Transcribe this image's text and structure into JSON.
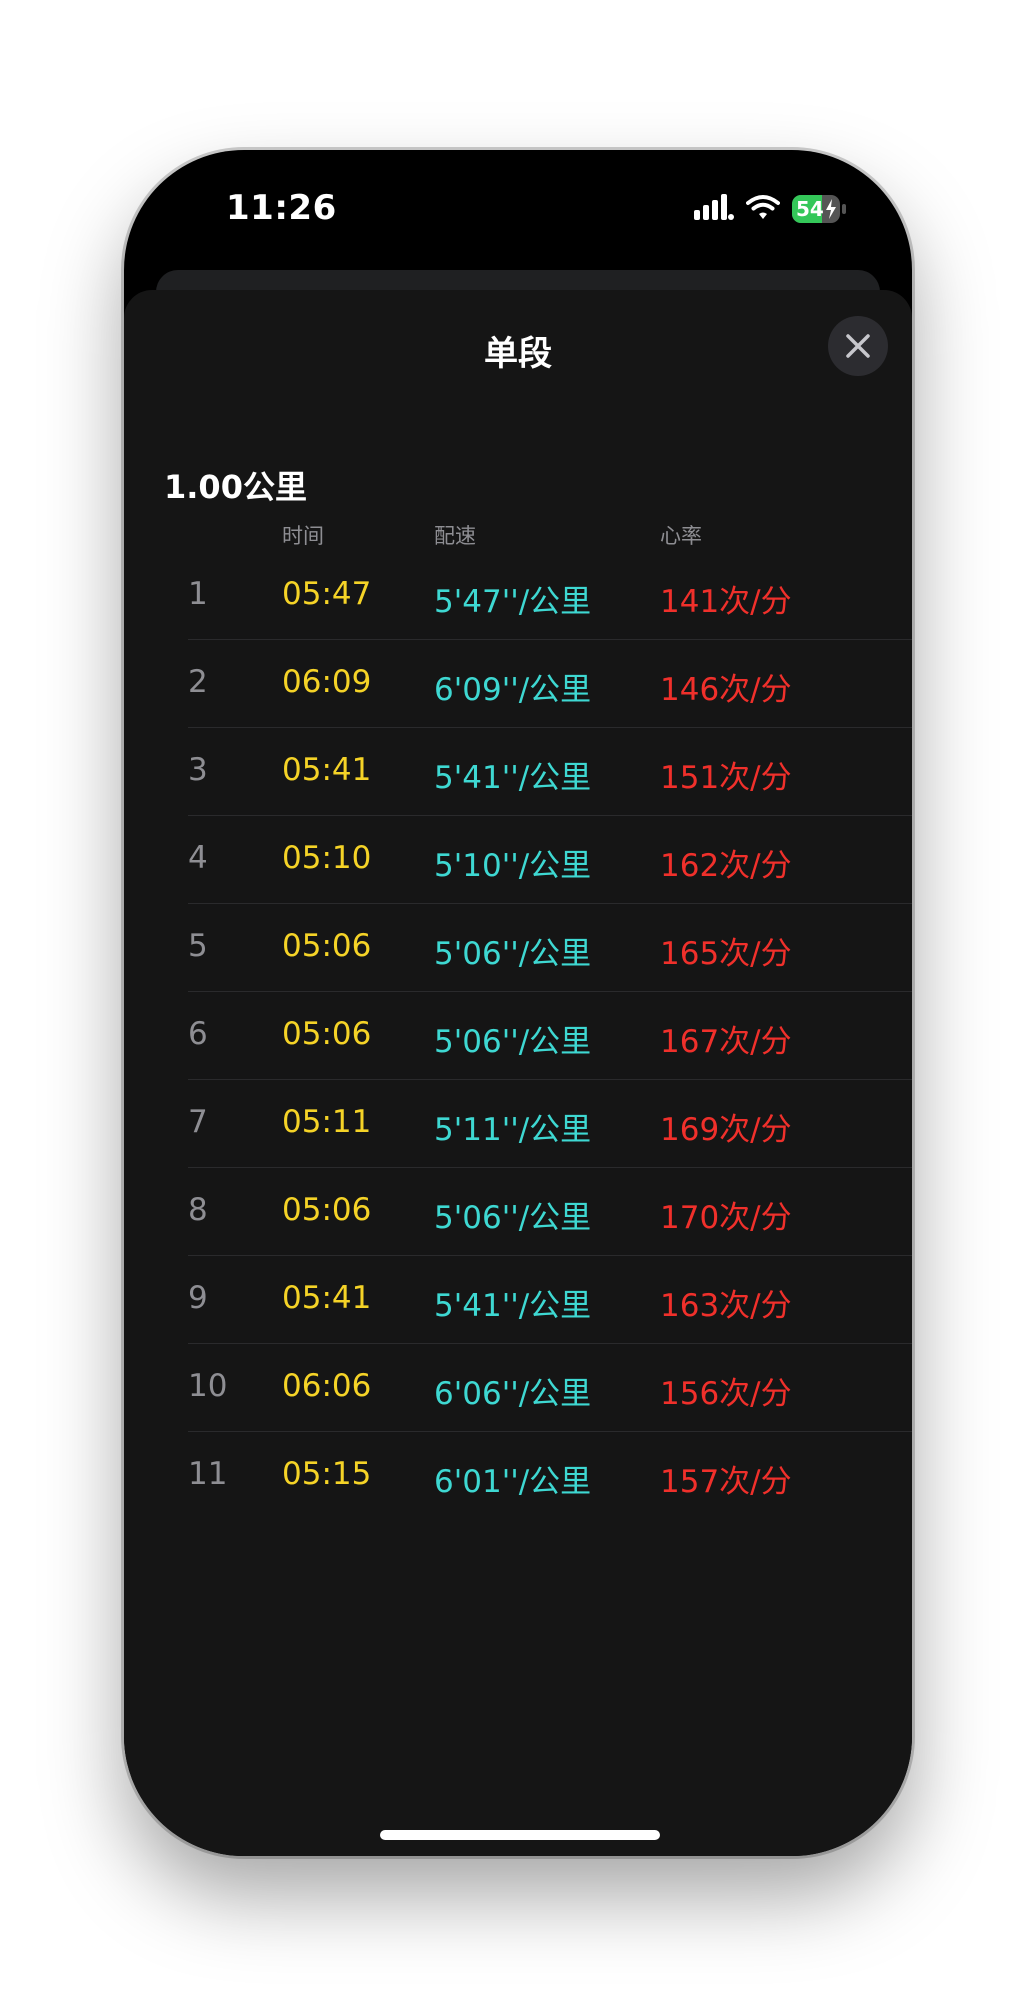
{
  "status_bar": {
    "time": "11:26",
    "battery": "54",
    "icons": [
      "signal-icon",
      "wifi-icon",
      "battery-charging-icon"
    ],
    "battery_color": "#34c759"
  },
  "sheet": {
    "title": "单段",
    "close_icon": "close-icon"
  },
  "section": {
    "label": "1.00公里"
  },
  "columns": {
    "time": "时间",
    "pace": "配速",
    "heart_rate": "心率"
  },
  "colors": {
    "time": "#f5d327",
    "pace": "#3ed8d2",
    "heart_rate": "#f0302b",
    "index": "#8e8e93",
    "background": "#151515"
  },
  "splits": [
    {
      "index": "1",
      "time": "05:47",
      "pace": "5'47''/公里",
      "heart_rate": "141次/分"
    },
    {
      "index": "2",
      "time": "06:09",
      "pace": "6'09''/公里",
      "heart_rate": "146次/分"
    },
    {
      "index": "3",
      "time": "05:41",
      "pace": "5'41''/公里",
      "heart_rate": "151次/分"
    },
    {
      "index": "4",
      "time": "05:10",
      "pace": "5'10''/公里",
      "heart_rate": "162次/分"
    },
    {
      "index": "5",
      "time": "05:06",
      "pace": "5'06''/公里",
      "heart_rate": "165次/分"
    },
    {
      "index": "6",
      "time": "05:06",
      "pace": "5'06''/公里",
      "heart_rate": "167次/分"
    },
    {
      "index": "7",
      "time": "05:11",
      "pace": "5'11''/公里",
      "heart_rate": "169次/分"
    },
    {
      "index": "8",
      "time": "05:06",
      "pace": "5'06''/公里",
      "heart_rate": "170次/分"
    },
    {
      "index": "9",
      "time": "05:41",
      "pace": "5'41''/公里",
      "heart_rate": "163次/分"
    },
    {
      "index": "10",
      "time": "06:06",
      "pace": "6'06''/公里",
      "heart_rate": "156次/分"
    },
    {
      "index": "11",
      "time": "05:15",
      "pace": "6'01''/公里",
      "heart_rate": "157次/分"
    }
  ]
}
